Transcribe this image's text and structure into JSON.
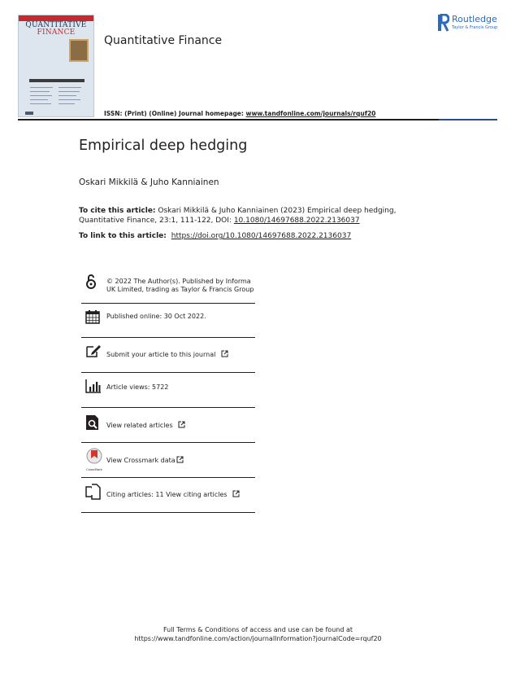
{
  "cover": {
    "title_line1": "QUANTITATIVE",
    "title_line2": "FINANCE"
  },
  "header": {
    "journal_title": "Quantitative Finance",
    "issn_prefix": "ISSN: (Print) (Online) Journal homepage: ",
    "homepage_url": "www.tandfonline.com/journals/rquf20",
    "publisher_name": "Routledge",
    "publisher_sub": "Taylor & Francis Group"
  },
  "article": {
    "title": "Empirical deep hedging",
    "authors": "Oskari Mikkilä & Juho Kanniainen",
    "cite_label": "To cite this article:",
    "cite_text": "Oskari Mikkilä & Juho Kanniainen (2023) Empirical deep hedging, Quantitative Finance, 23:1, 111-122, DOI: ",
    "cite_doi": "10.1080/14697688.2022.2136037",
    "link_label": "To link to this article:",
    "link_url": "https://doi.org/10.1080/14697688.2022.2136037"
  },
  "info": {
    "license": "© 2022 The Author(s). Published by Informa UK Limited, trading as Taylor & Francis Group",
    "published": "Published online: 30 Oct 2022.",
    "submit": "Submit your article to this journal",
    "views": "Article views: 5722",
    "related": "View related articles",
    "crossmark": "View Crossmark data",
    "crossmark_logo_text": "CrossMark",
    "citing": "Citing articles: 11 View citing articles"
  },
  "footer": {
    "line1": "Full Terms & Conditions of access and use can be found at",
    "line2": "https://www.tandfonline.com/action/journalInformation?journalCode=rquf20"
  },
  "colors": {
    "text": "#231f20",
    "brand_blue": "#2a6bc0",
    "accent_rule": "#2d4a8c",
    "cover_red": "#c9292c"
  },
  "icons": [
    "open-access-icon",
    "calendar-icon",
    "edit-icon",
    "bar-chart-icon",
    "search-document-icon",
    "crossmark-icon",
    "citing-articles-icon",
    "external-link-icon"
  ]
}
